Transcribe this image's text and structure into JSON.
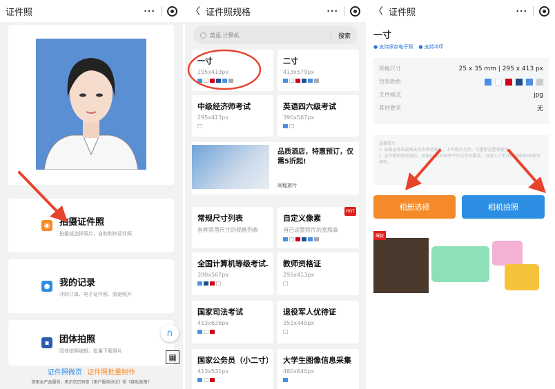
{
  "panel1": {
    "title": "证件照",
    "menu": [
      {
        "title": "拍摄证件照",
        "sub": "拍摄或选择照片，自助制作证件照"
      },
      {
        "title": "我的记录",
        "sub": "冲印订单、电子证件照、原始照片"
      },
      {
        "title": "团体拍照",
        "sub": "团体拍照编辑，批量下载照片"
      }
    ],
    "footer_links": [
      "证件照微页",
      "证件照批量制作"
    ],
    "legal": "使用本产品服务，表示您已同意《用户服务协议》和《隐私政策》"
  },
  "panel2": {
    "title": "证件照规格",
    "search_placeholder": "英语,计算机",
    "search_button": "搜索",
    "items": [
      {
        "name": "一寸",
        "size": "295x413px"
      },
      {
        "name": "二寸",
        "size": "413x579px"
      },
      {
        "name": "中级经济师考试",
        "size": "295x413px"
      },
      {
        "name": "英语四六级考试",
        "size": "390x567px"
      },
      {
        "name": "常规尺寸列表",
        "size": "各种常用尺寸的规格列表"
      },
      {
        "name": "自定义像素",
        "size": "自己设置照片的宽和高",
        "badge": "HOT"
      },
      {
        "name": "全国计算机等级考试…",
        "size": "390x567px"
      },
      {
        "name": "教师资格证",
        "size": "295x413px"
      },
      {
        "name": "国家司法考试",
        "size": "413x626px"
      },
      {
        "name": "退役军人优待证",
        "size": "352x440px"
      },
      {
        "name": "国家公务员（小二寸）",
        "size": "413x531px"
      },
      {
        "name": "大学生图像信息采集",
        "size": "480x640px"
      }
    ],
    "ad": {
      "text": "品质酒店，特惠预订，仅需5折起!",
      "brand": "同程旅行",
      "tag": "广告"
    }
  },
  "panel3": {
    "title": "证件照",
    "spec_name": "一寸",
    "badges": [
      "支持保存电子照",
      "支持冲印"
    ],
    "rows": [
      {
        "label": "规格尺寸",
        "value": "25 x 35 mm | 295 x 413 px"
      },
      {
        "label": "背景颜色",
        "value": ""
      },
      {
        "label": "文件格式",
        "value": "jpg"
      },
      {
        "label": "其他要求",
        "value": "无"
      }
    ],
    "notice_title": "温馨提示",
    "notice_1": "1. 如果选择的规格支持多种背景色，上传照片之后，可重新设置背景色。",
    "notice_2": "2. 证件照制作完成后，如果KB和分辨率不符合您的要求，可进入订单详情页修改KB和分辨率。",
    "btn_album": "相册选择",
    "btn_camera": "相机拍照",
    "banner_tag": "爆款"
  },
  "colors": {
    "orange": "#f58a2a",
    "blue": "#2d8fe3",
    "red_arrow": "#e8432d"
  }
}
